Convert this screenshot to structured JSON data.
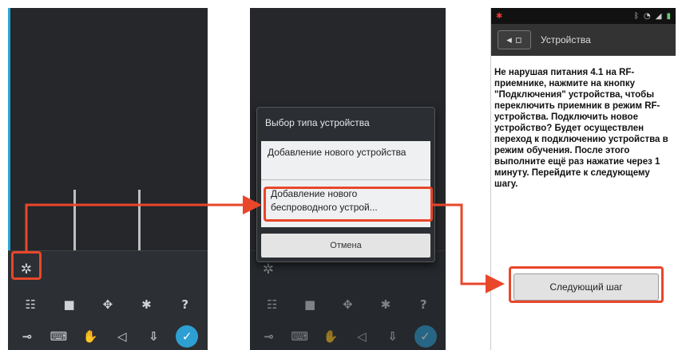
{
  "colors": {
    "highlight": "#e9462a",
    "accent": "#2e9fd2"
  },
  "panel1": {
    "toolbar_icons": [
      "table-icon",
      "square-icon",
      "pan-icon",
      "gear-icon",
      "help-icon"
    ],
    "toolbar_glyphs": [
      "☷",
      "■",
      "✥",
      "✱",
      "?"
    ],
    "bottom_icons": [
      "key-icon",
      "keyboard-icon",
      "hand-icon",
      "volume-icon",
      "pin-icon",
      "ok-icon"
    ],
    "bottom_glyphs": [
      "⊸",
      "⌨",
      "✋",
      "◁",
      "⇩",
      "✓"
    ]
  },
  "panel2": {
    "dialog_title": "Выбор типа устройства",
    "option1": "Добавление нового устройства",
    "option2": "Добавление нового беспроводного устрой...",
    "cancel": "Отмена"
  },
  "panel3": {
    "title": "Устройства",
    "back_glyph": "◂ ▫",
    "message": "Не нарушая питания 4.1 на RF-приемнике, нажмите на кнопку \"Подключения\" устройства, чтобы переключить приемник в режим RF-устройства. Подключить новое устройство? Будет осуществлен переход к подключению устройства в режим обучения. После этого выполните ещё раз нажатие через 1 минуту. Перейдите к следующему шагу.",
    "next_button": "Следующий шаг"
  }
}
